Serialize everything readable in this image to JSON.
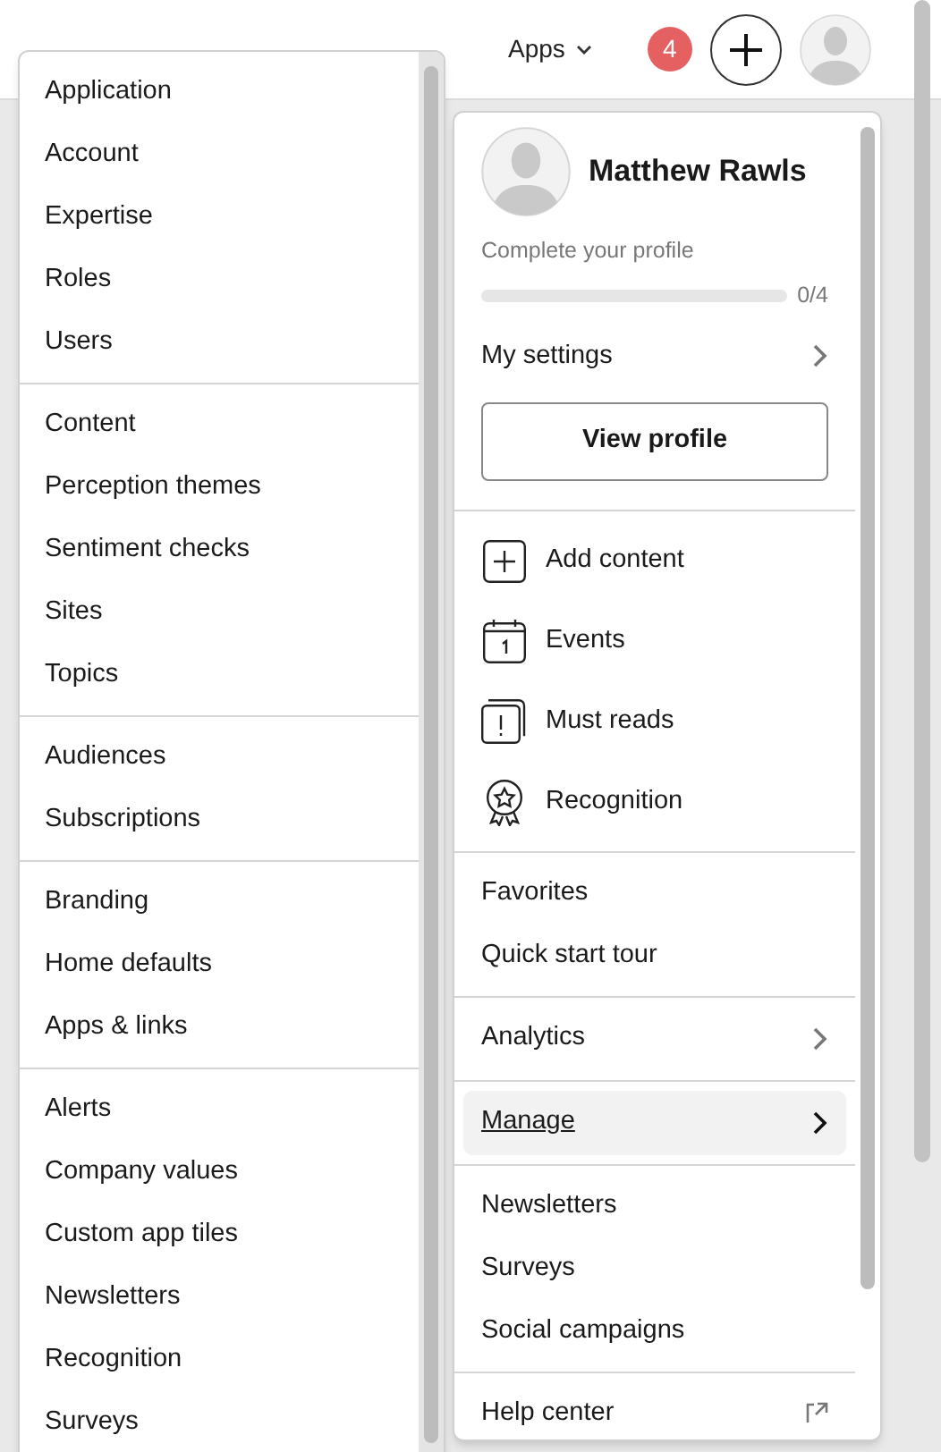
{
  "nav": [
    {
      "label": "Apps"
    }
  ],
  "notification_count": "4",
  "admin_menu": {
    "groups": [
      {
        "items": [
          "Application",
          "Account",
          "Expertise",
          "Roles",
          "Users"
        ]
      },
      {
        "items": [
          "Content",
          "Perception themes",
          "Sentiment checks",
          "Sites",
          "Topics"
        ]
      },
      {
        "items": [
          "Audiences",
          "Subscriptions"
        ]
      },
      {
        "items": [
          "Branding",
          "Home defaults",
          "Apps & links"
        ]
      },
      {
        "items": [
          "Alerts",
          "Company values",
          "Custom app tiles",
          "Newsletters",
          "Recognition",
          "Surveys"
        ]
      }
    ]
  },
  "profile_menu": {
    "name": "Matthew Rawls",
    "profile_prompt": "Complete your profile",
    "progress": {
      "level": 0,
      "reading": "0/4"
    },
    "settings_link": "My settings",
    "view_profile_button": "View profile",
    "sections": [
      {
        "items": [
          {
            "kind": "icon",
            "label": "Add content",
            "selected": false
          },
          {
            "kind": "icon",
            "label": "Events",
            "selected": false
          },
          {
            "kind": "icon",
            "label": "Must reads",
            "selected": false
          },
          {
            "kind": "icon",
            "label": "Recognition",
            "selected": false
          }
        ]
      },
      {
        "items": [
          {
            "kind": "link",
            "label": "Favorites",
            "selected": false
          },
          {
            "kind": "link",
            "label": "Quick start tour",
            "selected": false
          }
        ]
      },
      {
        "items": [
          {
            "kind": "submenu",
            "label": "Analytics",
            "selected": false
          }
        ]
      },
      {
        "items": [
          {
            "kind": "submenu",
            "label": "Manage",
            "selected": true
          }
        ]
      },
      {
        "items": [
          {
            "kind": "link",
            "label": "Newsletters",
            "selected": false
          },
          {
            "kind": "link",
            "label": "Surveys",
            "selected": false
          },
          {
            "kind": "link",
            "label": "Social campaigns",
            "selected": false
          }
        ]
      },
      {
        "items": [
          {
            "kind": "external",
            "label": "Help center",
            "selected": false
          }
        ]
      }
    ]
  }
}
